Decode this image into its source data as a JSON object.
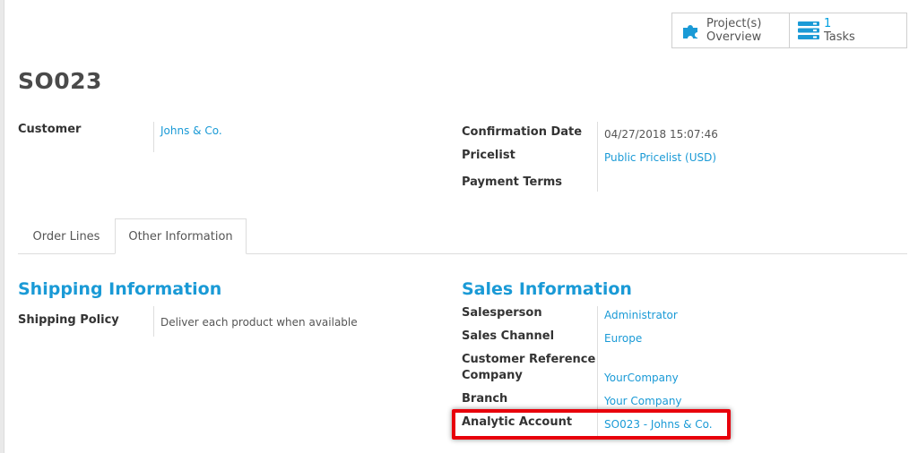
{
  "buttons": {
    "projects": {
      "line1": "Project(s)",
      "line2": "Overview",
      "icon": "puzzle-icon"
    },
    "tasks": {
      "count": "1",
      "label": "Tasks",
      "icon": "tasks-icon"
    }
  },
  "record": {
    "title": "SO023"
  },
  "header_fields": {
    "customer": {
      "label": "Customer",
      "value": "Johns & Co."
    },
    "confirmation_date": {
      "label": "Confirmation Date",
      "value": "04/27/2018 15:07:46"
    },
    "pricelist": {
      "label": "Pricelist",
      "value": "Public Pricelist (USD)"
    },
    "payment_terms": {
      "label": "Payment Terms",
      "value": ""
    }
  },
  "tabs": [
    {
      "label": "Order Lines",
      "active": false
    },
    {
      "label": "Other Information",
      "active": true
    }
  ],
  "shipping": {
    "title": "Shipping Information",
    "policy": {
      "label": "Shipping Policy",
      "value": "Deliver each product when available"
    }
  },
  "sales": {
    "title": "Sales Information",
    "salesperson": {
      "label": "Salesperson",
      "value": "Administrator"
    },
    "sales_channel": {
      "label": "Sales Channel",
      "value": "Europe"
    },
    "customer_ref_line1": "Customer Reference",
    "company": {
      "label": "Company",
      "value": "YourCompany"
    },
    "branch": {
      "label": "Branch",
      "value": "Your Company"
    },
    "analytic_account": {
      "label": "Analytic Account",
      "value": "SO023 - Johns & Co."
    }
  },
  "colors": {
    "accent": "#1a9ad6",
    "highlight": "#e8000b"
  }
}
